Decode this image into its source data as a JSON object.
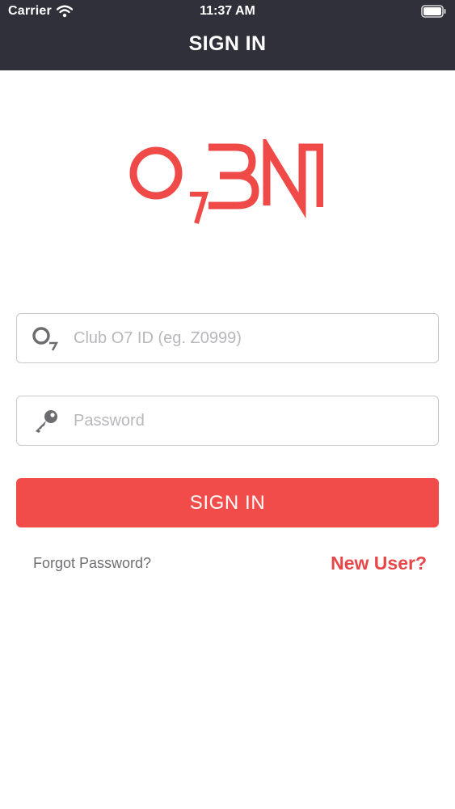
{
  "status_bar": {
    "carrier": "Carrier",
    "time": "11:37 AM"
  },
  "nav": {
    "title": "SIGN IN"
  },
  "logo": {
    "text": "O7BN"
  },
  "form": {
    "club_id_placeholder": "Club O7 ID (eg. Z0999)",
    "club_id_value": "",
    "password_placeholder": "Password",
    "password_value": ""
  },
  "actions": {
    "sign_in_label": "SIGN IN",
    "forgot_password_label": "Forgot Password?",
    "new_user_label": "New User?"
  },
  "icons": {
    "club_id": "o7-icon",
    "password": "key-icon",
    "wifi": "wifi-icon",
    "battery": "battery-icon"
  },
  "colors": {
    "header_bg": "#30303b",
    "accent": "#f24c4a",
    "link_accent": "#e8474a",
    "muted_text": "#6f6f73",
    "field_border": "#c9c9cc"
  }
}
